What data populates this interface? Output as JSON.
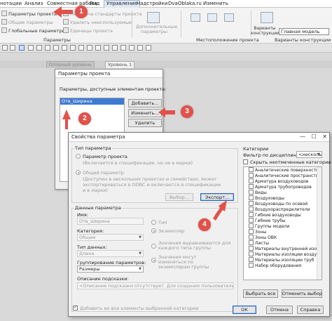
{
  "ribbon": {
    "tabs": [
      "нотации",
      "Анализ",
      "Совместная работа",
      "Вид",
      "Управление",
      "Надстройки",
      "DvaOblaka.ru",
      "Изменить"
    ],
    "active_tab": "Управление",
    "items": {
      "project_params": "Параметры проекта",
      "general_params": "Общие параметры",
      "global_params": "Глобальные параметры",
      "transfer_standards": "Передача стандарты проекта",
      "delete_unused": "Удалить неиспользуемые",
      "units": "Единицы проекта",
      "additional": "Дополнительные параметры",
      "location": "Местоположение проекта",
      "design_options": "Варианты конструкции",
      "main_model": "Главная модель"
    },
    "groups": {
      "params": "Параметры",
      "location": "Местоположение проекта",
      "options": "Варианты конструкции"
    }
  },
  "view_tabs": [
    "Опорный уровень",
    "Уровень 1"
  ],
  "proj_dialog": {
    "title": "Параметры проекта",
    "list_label": "Параметры, доступные элементам проекта:",
    "items": [
      "Отв_Ширина"
    ],
    "add_button": "Добавить...",
    "edit_button": "Изменить...",
    "delete_button": "Удалить"
  },
  "prop_dialog": {
    "title": "Свойства параметра",
    "param_type": {
      "legend": "Тип параметра",
      "project_param": "Параметр проекта",
      "project_note": "(Включается в спецификации, но не в марки)",
      "shared_param": "Общий параметр",
      "shared_note": "(Доступен в нескольких проектах и семействах, может экспортироваться в ODBC и включается в спецификации и в марки)",
      "select_button": "Выбор...",
      "export_button": "Экспорт..."
    },
    "data": {
      "legend": "Данные параметра",
      "name_label": "Имя:",
      "name_value": "Отв_Ширина",
      "category_label": "Категория:",
      "category_value": "Общие",
      "type_label": "Тип",
      "instance_label": "Экземпляр",
      "datatype_label": "Тип данных:",
      "datatype_value": "Длина",
      "group_label": "Группирование параметров:",
      "group_value": "Размеры",
      "values_aligned": "Значения выравниваются для каждого типа группы",
      "values_vary": "Значения могут изменяться по экземплярам группы",
      "tooltip_label": "Описание подсказки:",
      "tooltip_value": "<Описание подсказки отсутствует. Для создания пользовательской подсказки отр",
      "add_all_label": "Добавить во все элементы выбранной категории"
    },
    "categories": {
      "legend": "Категории",
      "filter_label": "Фильтр по дисциплинам:",
      "filter_value": "<несколь",
      "hide_unchecked": "Скрыть неотмеченные категории",
      "items": [
        "Аналитические поверхности",
        "Аналитические пространства",
        "Арматура воздуховодов",
        "Арматура трубопроводов",
        "Виды",
        "Воздуховоды",
        "Воздуховоды по осевой",
        "Воздухораспределители",
        "Гибкие воздуховоды",
        "Гибкие трубы",
        "Группы модели",
        "Зоны",
        "Зоны ОВК",
        "Листы",
        "Материалы внутренней изоляц",
        "Материалы изоляции воздухо",
        "Материалы изоляции труб",
        "Набор оборудования"
      ],
      "select_all_button": "Выбрать все",
      "clear_button": "Отменить выбор"
    },
    "ok_button": "ОК",
    "cancel_button": "Отмена",
    "help_button": "Справка"
  },
  "markers": [
    "1",
    "2",
    "3",
    "4"
  ]
}
